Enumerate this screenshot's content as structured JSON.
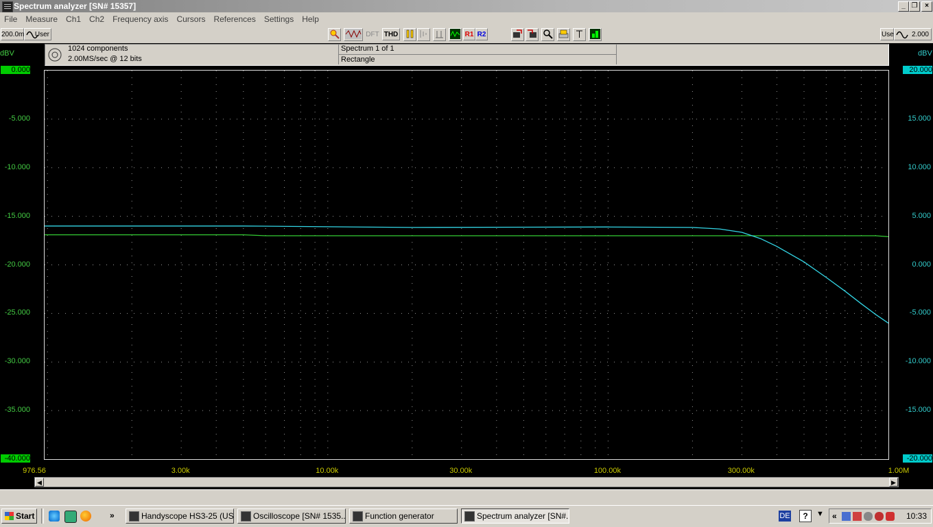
{
  "window": {
    "title": "Spectrum analyzer  [SN# 15357]",
    "minimize": "_",
    "restore": "❐",
    "close": "×"
  },
  "menu": [
    "File",
    "Measure",
    "Ch1",
    "Ch2",
    "Frequency axis",
    "Cursors",
    "References",
    "Settings",
    "Help"
  ],
  "toolbar": {
    "left_range": "200.0m",
    "left_mode": "User",
    "right_mode": "User",
    "right_range": "2.000",
    "dft": "DFT",
    "thd": "THD",
    "r1": "R1",
    "r2": "R2"
  },
  "info": {
    "components": "1024 components",
    "sample_rate": "2.00MS/sec @ 12 bits",
    "spectrum": "Spectrum 1 of 1",
    "window": "Rectangle"
  },
  "chart_data": {
    "type": "line",
    "x_scale": "log",
    "xlim": [
      976.56,
      1000000
    ],
    "x_tick_labels": [
      "976.56",
      "3.00k",
      "10.00k",
      "30.00k",
      "100.00k",
      "300.00k",
      "1.00M"
    ],
    "x_tick_values": [
      976.56,
      3000,
      10000,
      30000,
      100000,
      300000,
      1000000
    ],
    "left_axis": {
      "unit": "dBV",
      "ylim": [
        -40,
        0
      ],
      "tick_labels": [
        "0.000",
        "-5.000",
        "-10.000",
        "-15.000",
        "-20.000",
        "-25.000",
        "-30.000",
        "-35.000",
        "-40.000"
      ],
      "color": "#00cc00"
    },
    "right_axis": {
      "unit": "dBV",
      "ylim": [
        -20,
        20
      ],
      "tick_labels": [
        "20.000",
        "15.000",
        "10.000",
        "5.000",
        "0.000",
        "-5.000",
        "-10.000",
        "-15.000",
        "-20.000"
      ],
      "color": "#00cccc"
    },
    "grid": "dotted",
    "series": [
      {
        "axis": "left",
        "color": "#33cc33",
        "x": [
          976.56,
          5000,
          6000,
          100000,
          500000,
          900000,
          1000000
        ],
        "y": [
          -16.9,
          -16.9,
          -17.0,
          -17.0,
          -17.0,
          -17.0,
          -17.1
        ]
      },
      {
        "axis": "right",
        "color": "#33d6e6",
        "x": [
          976.56,
          5000,
          20000,
          100000,
          200000,
          250000,
          300000,
          350000,
          400000,
          500000,
          600000,
          700000,
          800000,
          900000,
          1000000
        ],
        "y": [
          4.0,
          4.0,
          3.85,
          3.9,
          3.85,
          3.7,
          3.35,
          2.7,
          1.9,
          0.3,
          -1.3,
          -2.7,
          -4.0,
          -5.1,
          -6.0
        ]
      }
    ]
  },
  "status": "",
  "taskbar": {
    "start": "Start",
    "more": "»",
    "tasks": [
      {
        "label": "Handyscope HS3-25 (US...",
        "active": false
      },
      {
        "label": "Oscilloscope  [SN# 1535...",
        "active": false
      },
      {
        "label": "Function generator",
        "active": false
      },
      {
        "label": "Spectrum analyzer  [SN#...",
        "active": true
      }
    ],
    "lang": "DE",
    "help": "?",
    "tray_chevron": "«",
    "clock": "10:33"
  }
}
